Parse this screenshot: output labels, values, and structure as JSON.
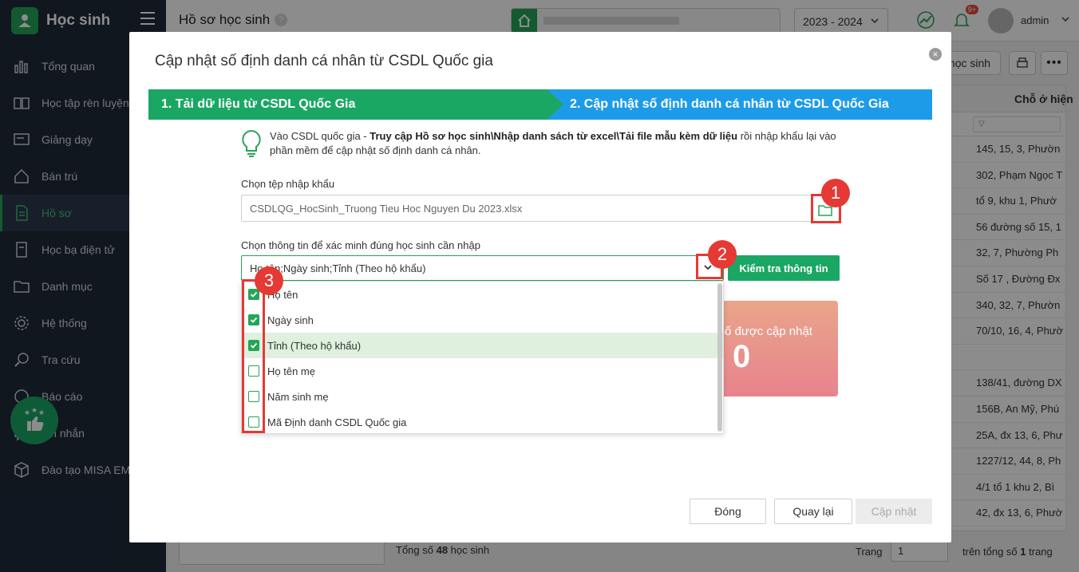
{
  "app": {
    "name": "Học sinh"
  },
  "sidebar": {
    "items": [
      {
        "label": "Tổng quan",
        "icon": "chart-icon"
      },
      {
        "label": "Học tập rèn luyện",
        "icon": "book-icon"
      },
      {
        "label": "Giảng dạy",
        "icon": "board-icon"
      },
      {
        "label": "Bán trú",
        "icon": "home-icon"
      },
      {
        "label": "Hồ sơ",
        "icon": "document-icon",
        "active": true
      },
      {
        "label": "Học bạ điện tử",
        "icon": "record-icon"
      },
      {
        "label": "Danh mục",
        "icon": "folder-icon"
      },
      {
        "label": "Hệ thống",
        "icon": "gear-icon"
      },
      {
        "label": "Tra cứu",
        "icon": "search-icon"
      },
      {
        "label": "Báo cáo",
        "icon": "report-icon"
      },
      {
        "label": "Tin nhắn",
        "icon": "message-icon"
      },
      {
        "label": "Đào tạo MISA EMIS",
        "icon": "cube-icon"
      }
    ]
  },
  "header": {
    "page_title": "Hồ sơ học sinh",
    "help": "?",
    "year": "2023 - 2024",
    "notif_badge": "9+",
    "user": "admin"
  },
  "background": {
    "btn_add": "học sinh",
    "column_header": "Chỗ ở hiện",
    "rows": [
      "145, 15, 3, Phườn",
      "302, Phạm Ngọc T",
      "tổ 9, khu 1, Phườ",
      "56 đường số 15, 1",
      "32, 7, Phường Ph",
      "Số 17 , Đường Đx",
      "340, 32, 7, Phườn",
      "70/10, 16, 4, Phườ",
      "",
      "138/41, đường DX",
      "156B, An Mỹ, Phú",
      "25A, đx 13, 6, Phư",
      "1227/12, 44, 8, Ph",
      "4/1 tổ 1 khu 2, Bì",
      "42, đx 13, 6, Phườ"
    ],
    "total_prefix": "Tổng số ",
    "total_count": "48",
    "total_suffix": " học sinh",
    "page_label": "Trang",
    "page_value": "1",
    "page_of_prefix": "trên tổng số ",
    "page_of_count": "1",
    "page_of_suffix": " trang"
  },
  "modal": {
    "title": "Cập nhật số định danh cá nhân từ CSDL Quốc gia",
    "close": "×",
    "step1": "1. Tải dữ liệu từ CSDL Quốc Gia",
    "step2": "2. Cập nhật số định danh cá nhân từ CSDL Quốc Gia",
    "hint_prefix": "Vào CSDL quốc gia - ",
    "hint_bold": "Truy cập Hồ sơ học sinh\\Nhập danh sách từ excel\\Tải file mẫu kèm dữ liệu",
    "hint_suffix": " rồi nhập khẩu lại vào phần mềm để cập nhật số định danh cá nhân.",
    "file_label": "Chọn tệp nhập khẩu",
    "file_value": "CSDLQG_HocSinh_Truong Tieu Hoc Nguyen Du 2023.xlsx",
    "verify_label": "Chọn thông tin để xác minh đúng học sinh cần nhập",
    "combo_value": "Họ tên;Ngày sinh;Tỉnh (Theo hộ khẩu)",
    "check_button": "Kiểm tra thông tin",
    "stat_label": "Số được cập nhật",
    "stat_value": "0",
    "options": [
      {
        "label": "Họ tên",
        "checked": true
      },
      {
        "label": "Ngày sinh",
        "checked": true
      },
      {
        "label": "Tỉnh (Theo hộ khẩu)",
        "checked": true
      },
      {
        "label": "Họ tên mẹ",
        "checked": false
      },
      {
        "label": "Năm sinh mẹ",
        "checked": false
      },
      {
        "label": "Mã Định danh CSDL Quốc gia",
        "checked": false
      }
    ],
    "btn_close": "Đóng",
    "btn_back": "Quay lại",
    "btn_update": "Cập nhật"
  },
  "annotations": [
    "1",
    "2",
    "3"
  ],
  "colors": {
    "primary_green": "#1aa764",
    "step_blue": "#1e9be8",
    "annotation_red": "#e53935",
    "sidebar_bg": "#1e2a3a"
  }
}
